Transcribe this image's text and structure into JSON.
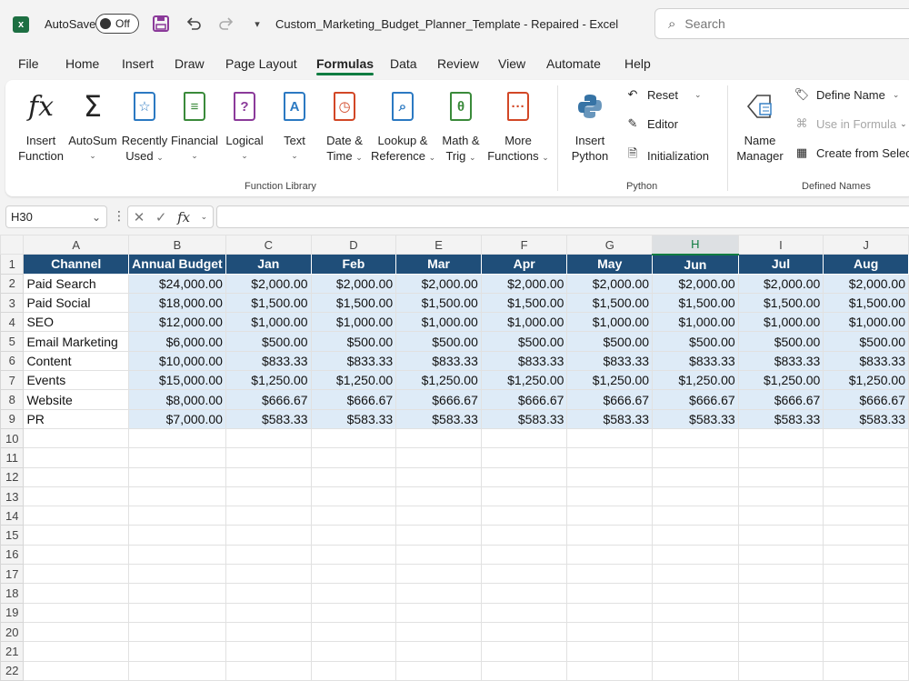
{
  "titlebar": {
    "autosave_label": "AutoSave",
    "autosave_state": "Off",
    "document_title": "Custom_Marketing_Budget_Planner_Template  -  Repaired  -  Excel",
    "search_placeholder": "Search"
  },
  "menu": [
    "File",
    "Home",
    "Insert",
    "Draw",
    "Page Layout",
    "Formulas",
    "Data",
    "Review",
    "View",
    "Automate",
    "Help"
  ],
  "menu_active": "Formulas",
  "ribbon": {
    "function_library": {
      "label": "Function Library",
      "insert_function": [
        "Insert",
        "Function"
      ],
      "autosum": "AutoSum",
      "recently_used": [
        "Recently",
        "Used"
      ],
      "financial": "Financial",
      "logical": "Logical",
      "text": "Text",
      "date_time": [
        "Date &",
        "Time"
      ],
      "lookup": [
        "Lookup &",
        "Reference"
      ],
      "math": [
        "Math &",
        "Trig"
      ],
      "more": [
        "More",
        "Functions"
      ]
    },
    "python": {
      "label": "Python",
      "insert_python": [
        "Insert",
        "Python"
      ],
      "reset": "Reset",
      "editor": "Editor",
      "initialization": "Initialization"
    },
    "defined_names": {
      "label": "Defined Names",
      "name_manager": [
        "Name",
        "Manager"
      ],
      "define_name": "Define Name",
      "use_in_formula": "Use in Formula",
      "create_from_selection": "Create from Selec"
    }
  },
  "formula_bar": {
    "name_box": "H30",
    "formula": ""
  },
  "sheet": {
    "columns": [
      "A",
      "B",
      "C",
      "D",
      "E",
      "F",
      "G",
      "H",
      "I",
      "J"
    ],
    "selected_column": "H",
    "header": [
      "Channel",
      "Annual Budget",
      "Jan",
      "Feb",
      "Mar",
      "Apr",
      "May",
      "Jun",
      "Jul",
      "Aug"
    ],
    "rows": [
      [
        "Paid Search",
        "$24,000.00",
        "$2,000.00",
        "$2,000.00",
        "$2,000.00",
        "$2,000.00",
        "$2,000.00",
        "$2,000.00",
        "$2,000.00",
        "$2,000.00"
      ],
      [
        "Paid Social",
        "$18,000.00",
        "$1,500.00",
        "$1,500.00",
        "$1,500.00",
        "$1,500.00",
        "$1,500.00",
        "$1,500.00",
        "$1,500.00",
        "$1,500.00"
      ],
      [
        "SEO",
        "$12,000.00",
        "$1,000.00",
        "$1,000.00",
        "$1,000.00",
        "$1,000.00",
        "$1,000.00",
        "$1,000.00",
        "$1,000.00",
        "$1,000.00"
      ],
      [
        "Email Marketing",
        "$6,000.00",
        "$500.00",
        "$500.00",
        "$500.00",
        "$500.00",
        "$500.00",
        "$500.00",
        "$500.00",
        "$500.00"
      ],
      [
        "Content",
        "$10,000.00",
        "$833.33",
        "$833.33",
        "$833.33",
        "$833.33",
        "$833.33",
        "$833.33",
        "$833.33",
        "$833.33"
      ],
      [
        "Events",
        "$15,000.00",
        "$1,250.00",
        "$1,250.00",
        "$1,250.00",
        "$1,250.00",
        "$1,250.00",
        "$1,250.00",
        "$1,250.00",
        "$1,250.00"
      ],
      [
        "Website",
        "$8,000.00",
        "$666.67",
        "$666.67",
        "$666.67",
        "$666.67",
        "$666.67",
        "$666.67",
        "$666.67",
        "$666.67"
      ],
      [
        "PR",
        "$7,000.00",
        "$583.33",
        "$583.33",
        "$583.33",
        "$583.33",
        "$583.33",
        "$583.33",
        "$583.33",
        "$583.33"
      ]
    ],
    "row_numbers": [
      "1",
      "2",
      "3",
      "4",
      "5",
      "6",
      "7",
      "8",
      "9",
      "10",
      "11",
      "12",
      "13",
      "14",
      "15",
      "16",
      "17",
      "18",
      "19",
      "20",
      "21",
      "22"
    ]
  },
  "colors": {
    "header_fill": "#1f4e79",
    "data_fill": "#deebf7",
    "accent": "#107c41"
  }
}
